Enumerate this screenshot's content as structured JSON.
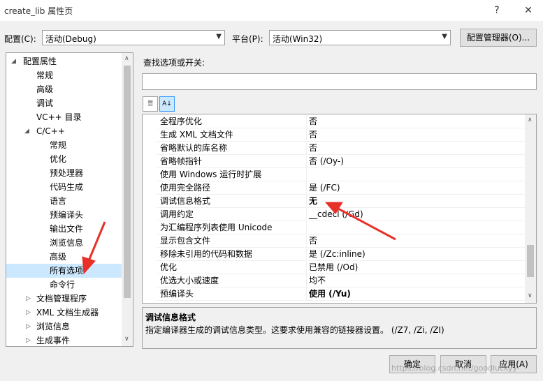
{
  "window": {
    "title": "create_lib 属性页",
    "help": "?",
    "close": "✕"
  },
  "config": {
    "label": "配置(C):",
    "value": "活动(Debug)"
  },
  "platform": {
    "label": "平台(P):",
    "value": "活动(Win32)"
  },
  "config_manager": "配置管理器(O)...",
  "search": {
    "label": "查找选项或开关:",
    "value": ""
  },
  "tree": {
    "root": "配置属性",
    "general": "常规",
    "advanced": "高级",
    "debugging": "调试",
    "vcdirs": "VC++ 目录",
    "cpp": "C/C++",
    "cpp_general": "常规",
    "cpp_optimization": "优化",
    "cpp_preprocessor": "预处理器",
    "cpp_codegen": "代码生成",
    "cpp_language": "语言",
    "cpp_pch": "预编译头",
    "cpp_output": "输出文件",
    "cpp_browse": "浏览信息",
    "cpp_advanced": "高级",
    "cpp_all": "所有选项",
    "cpp_cmdline": "命令行",
    "librarian": "文档管理程序",
    "xmldoc": "XML 文档生成器",
    "browse_info": "浏览信息",
    "build_events": "生成事件"
  },
  "grid": {
    "rows": [
      {
        "name": "全程序优化",
        "value": "否"
      },
      {
        "name": "生成 XML 文档文件",
        "value": "否"
      },
      {
        "name": "省略默认的库名称",
        "value": "否"
      },
      {
        "name": "省略帧指针",
        "value": "否 (/Oy-)"
      },
      {
        "name": "使用 Windows 运行时扩展",
        "value": ""
      },
      {
        "name": "使用完全路径",
        "value": "是 (/FC)"
      },
      {
        "name": "调试信息格式",
        "value": "无"
      },
      {
        "name": "调用约定",
        "value": "__cdecl (/Gd)"
      },
      {
        "name": "为汇编程序列表使用 Unicode",
        "value": ""
      },
      {
        "name": "显示包含文件",
        "value": "否"
      },
      {
        "name": "移除未引用的代码和数据",
        "value": "是 (/Zc:inline)"
      },
      {
        "name": "优化",
        "value": "已禁用 (/Od)"
      },
      {
        "name": "优选大小或速度",
        "value": "均不"
      },
      {
        "name": "预编译头",
        "value": "使用 (/Yu)"
      }
    ]
  },
  "description": {
    "title": "调试信息格式",
    "text": "指定编译器生成的调试信息类型。这要求使用兼容的链接器设置。 (/Z7, /Zi, /ZI)"
  },
  "buttons": {
    "ok": "确定",
    "cancel": "取消",
    "apply": "应用(A)"
  },
  "watermark": "https://blog.csdn.net/goodluckyy",
  "colors": {
    "selection": "#cce8ff",
    "annotation_arrow": "#e8302b"
  }
}
